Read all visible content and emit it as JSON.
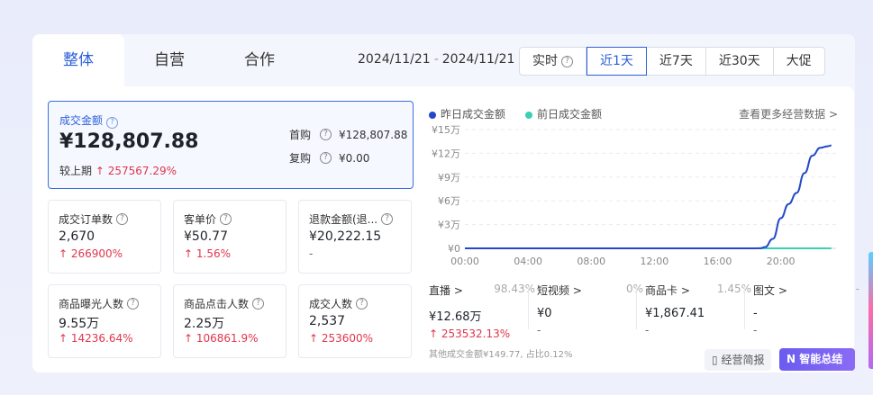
{
  "tabs": [
    "整体",
    "自营",
    "合作"
  ],
  "date_range": {
    "start": "2024/11/21",
    "end": "2024/11/21"
  },
  "ranges": {
    "realtime": "实时",
    "options": [
      "近1天",
      "近7天",
      "近30天",
      "大促"
    ]
  },
  "main_metric": {
    "label": "成交金额",
    "value": "¥128,807.88",
    "compare_label": "较上期",
    "compare_value": "257567.29%",
    "first_purchase_label": "首购",
    "first_purchase_value": "¥128,807.88",
    "repurchase_label": "复购",
    "repurchase_value": "¥0.00"
  },
  "metrics": [
    {
      "label": "成交订单数",
      "value": "2,670",
      "change": "266900%"
    },
    {
      "label": "客单价",
      "value": "¥50.77",
      "change": "1.56%"
    },
    {
      "label": "退款金额(退...",
      "value": "¥20,222.15",
      "change": "-"
    },
    {
      "label": "商品曝光人数",
      "value": "9.55万",
      "change": "14236.64%"
    },
    {
      "label": "商品点击人数",
      "value": "2.25万",
      "change": "106861.9%"
    },
    {
      "label": "成交人数",
      "value": "2,537",
      "change": "253600%"
    }
  ],
  "legend": [
    "昨日成交金额",
    "前日成交金额"
  ],
  "more_link": "查看更多经营数据 >",
  "channels": [
    {
      "name": "直播 >",
      "pct": "98.43%",
      "value": "¥12.68万",
      "change": "253532.13%"
    },
    {
      "name": "短视频 >",
      "pct": "0%",
      "value": "¥0",
      "change": "-"
    },
    {
      "name": "商品卡 >",
      "pct": "1.45%",
      "value": "¥1,867.41",
      "change": "-"
    },
    {
      "name": "图文 >",
      "pct": "-",
      "value": "-",
      "change": "-"
    }
  ],
  "other_note": "其他成交金额¥149.77, 占比0.12%",
  "buttons": {
    "report": "经营简报",
    "ai_summary": "智能总结"
  },
  "chart_data": {
    "type": "line",
    "y_tick_labels": [
      "¥0",
      "¥3万",
      "¥6万",
      "¥9万",
      "¥12万",
      "¥15万"
    ],
    "x_tick_labels": [
      "00:00",
      "04:00",
      "08:00",
      "12:00",
      "16:00",
      "20:00"
    ],
    "ylim": [
      0,
      150000
    ],
    "xlim": [
      0,
      23.5
    ],
    "grid": true,
    "legend_position": "top-left",
    "colors": {
      "yesterday": "#2448c9",
      "day_before": "#3ccfb1"
    },
    "series": [
      {
        "name": "昨日成交金额",
        "x": [
          0,
          18,
          18.7,
          19,
          19.5,
          20,
          20.5,
          21,
          21.5,
          22,
          22.5,
          23,
          23.2
        ],
        "values": [
          0,
          0,
          100,
          1500,
          12000,
          38000,
          56000,
          70000,
          95000,
          117000,
          127000,
          129000,
          130000
        ]
      },
      {
        "name": "前日成交金额",
        "x": [
          0,
          23.2
        ],
        "values": [
          0,
          0
        ]
      }
    ]
  }
}
